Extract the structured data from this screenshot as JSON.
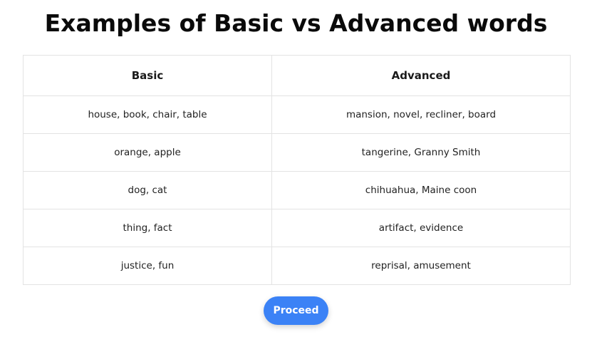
{
  "page": {
    "title": "Examples of Basic vs Advanced words"
  },
  "table": {
    "headers": [
      "Basic",
      "Advanced"
    ],
    "rows": [
      [
        "house, book, chair, table",
        "mansion, novel, recliner, board"
      ],
      [
        "orange, apple",
        "tangerine, Granny Smith"
      ],
      [
        "dog, cat",
        "chihuahua, Maine coon"
      ],
      [
        "thing, fact",
        "artifact, evidence"
      ],
      [
        "justice, fun",
        "reprisal, amusement"
      ]
    ]
  },
  "actions": {
    "proceed_label": "Proceed"
  },
  "colors": {
    "accent": "#3b82f6",
    "border": "#e3e3e3",
    "text": "#111111"
  }
}
